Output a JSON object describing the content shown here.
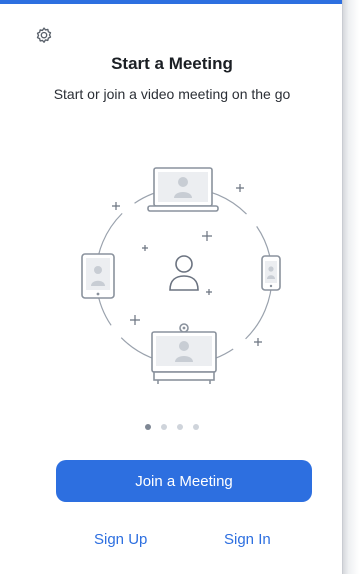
{
  "app": {
    "title": "Start a Meeting",
    "subtitle": "Start or join a video meeting on the go",
    "settings_icon": "gear-icon"
  },
  "carousel": {
    "count": 4,
    "active_index": 0
  },
  "buttons": {
    "join_label": "Join a Meeting",
    "signup_label": "Sign Up",
    "signin_label": "Sign In"
  },
  "colors": {
    "accent": "#2d6fe0",
    "text_dark": "#1b1f24"
  },
  "illustration": {
    "icons": [
      "laptop-icon",
      "tablet-icon",
      "phone-icon",
      "user-icon",
      "conference-screen-icon"
    ]
  }
}
